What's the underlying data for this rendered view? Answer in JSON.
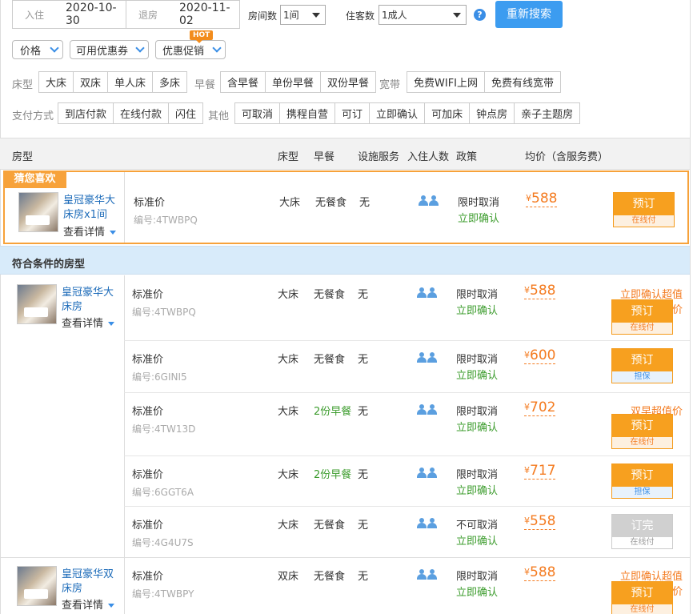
{
  "search": {
    "checkin_label": "入住",
    "checkin": "2020-10-30",
    "checkout_label": "退房",
    "checkout": "2020-11-02",
    "rooms_label": "房间数",
    "rooms": "1间",
    "guests_label": "住客数",
    "guests": "1成人",
    "help": "?",
    "research_button": "重新搜索"
  },
  "filters": {
    "price": "价格",
    "coupon": "可用优惠券",
    "promo": "优惠促销",
    "hot": "HOT",
    "bed_label": "床型",
    "bed": [
      "大床",
      "双床",
      "单人床",
      "多床"
    ],
    "breakfast_label": "早餐",
    "breakfast": [
      "含早餐",
      "单份早餐",
      "双份早餐"
    ],
    "broadband_label": "宽带",
    "broadband": [
      "免费WIFI上网",
      "免费有线宽带"
    ],
    "pay_label": "支付方式",
    "pay": [
      "到店付款",
      "在线付款",
      "闪住"
    ],
    "other_label": "其他",
    "other": [
      "可取消",
      "携程自营",
      "可订",
      "立即确认",
      "可加床",
      "钟点房",
      "亲子主题房"
    ]
  },
  "table_header": {
    "room_type": "房型",
    "bed": "床型",
    "breakfast": "早餐",
    "services": "设施服务",
    "occupancy": "入住人数",
    "policy": "政策",
    "price": "均价（含服务费）"
  },
  "guess": {
    "tag": "猜您喜欢",
    "room_name": "皇冠豪华大床房x1间",
    "detail": "查看详情",
    "plan": "标准价",
    "code": "编号:4TWBPQ",
    "bed": "大床",
    "breakfast": "无餐食",
    "service": "无",
    "policy1": "限时取消",
    "policy2": "立即确认",
    "currency": "¥",
    "price": "588",
    "book": "预订",
    "book_sub": "在线付"
  },
  "section_title": "符合条件的房型",
  "room1": {
    "name": "皇冠豪华大床房",
    "detail": "查看详情",
    "rows": [
      {
        "plan": "标准价",
        "code": "编号:4TWBPQ",
        "bed": "大床",
        "breakfast": "无餐食",
        "service": "无",
        "policy1": "限时取消",
        "policy2": "立即确认",
        "currency": "¥",
        "price": "588",
        "promo": "立即确认超值价",
        "book": "预订",
        "book_sub": "在线付"
      },
      {
        "plan": "标准价",
        "code": "编号:6GINI5",
        "bed": "大床",
        "breakfast": "无餐食",
        "service": "无",
        "policy1": "限时取消",
        "policy2": "立即确认",
        "currency": "¥",
        "price": "600",
        "promo": "",
        "book": "预订",
        "book_sub": "担保"
      },
      {
        "plan": "标准价",
        "code": "编号:4TW13D",
        "bed": "大床",
        "breakfast": "2份早餐",
        "service": "无",
        "policy1": "限时取消",
        "policy2": "立即确认",
        "currency": "¥",
        "price": "702",
        "promo": "双早超值价",
        "book": "预订",
        "book_sub": "在线付"
      },
      {
        "plan": "标准价",
        "code": "编号:6GGT6A",
        "bed": "大床",
        "breakfast": "2份早餐",
        "service": "无",
        "policy1": "限时取消",
        "policy2": "立即确认",
        "currency": "¥",
        "price": "717",
        "promo": "",
        "book": "预订",
        "book_sub": "担保"
      },
      {
        "plan": "标准价",
        "code": "编号:4G4U7S",
        "bed": "大床",
        "breakfast": "无餐食",
        "service": "无",
        "policy1": "不可取消",
        "policy2": "立即确认",
        "currency": "¥",
        "price": "558",
        "promo": "",
        "book": "订完",
        "book_sub": "在线付"
      }
    ]
  },
  "room2": {
    "name": "皇冠豪华双床房",
    "detail": "查看详情",
    "rows": [
      {
        "plan": "标准价",
        "code": "编号:4TWBPY",
        "bed": "双床",
        "breakfast": "无餐食",
        "service": "无",
        "policy1": "限时取消",
        "policy2": "立即确认",
        "currency": "¥",
        "price": "588",
        "promo": "立即确认超值价",
        "book": "预订",
        "book_sub": "在线付"
      }
    ]
  }
}
